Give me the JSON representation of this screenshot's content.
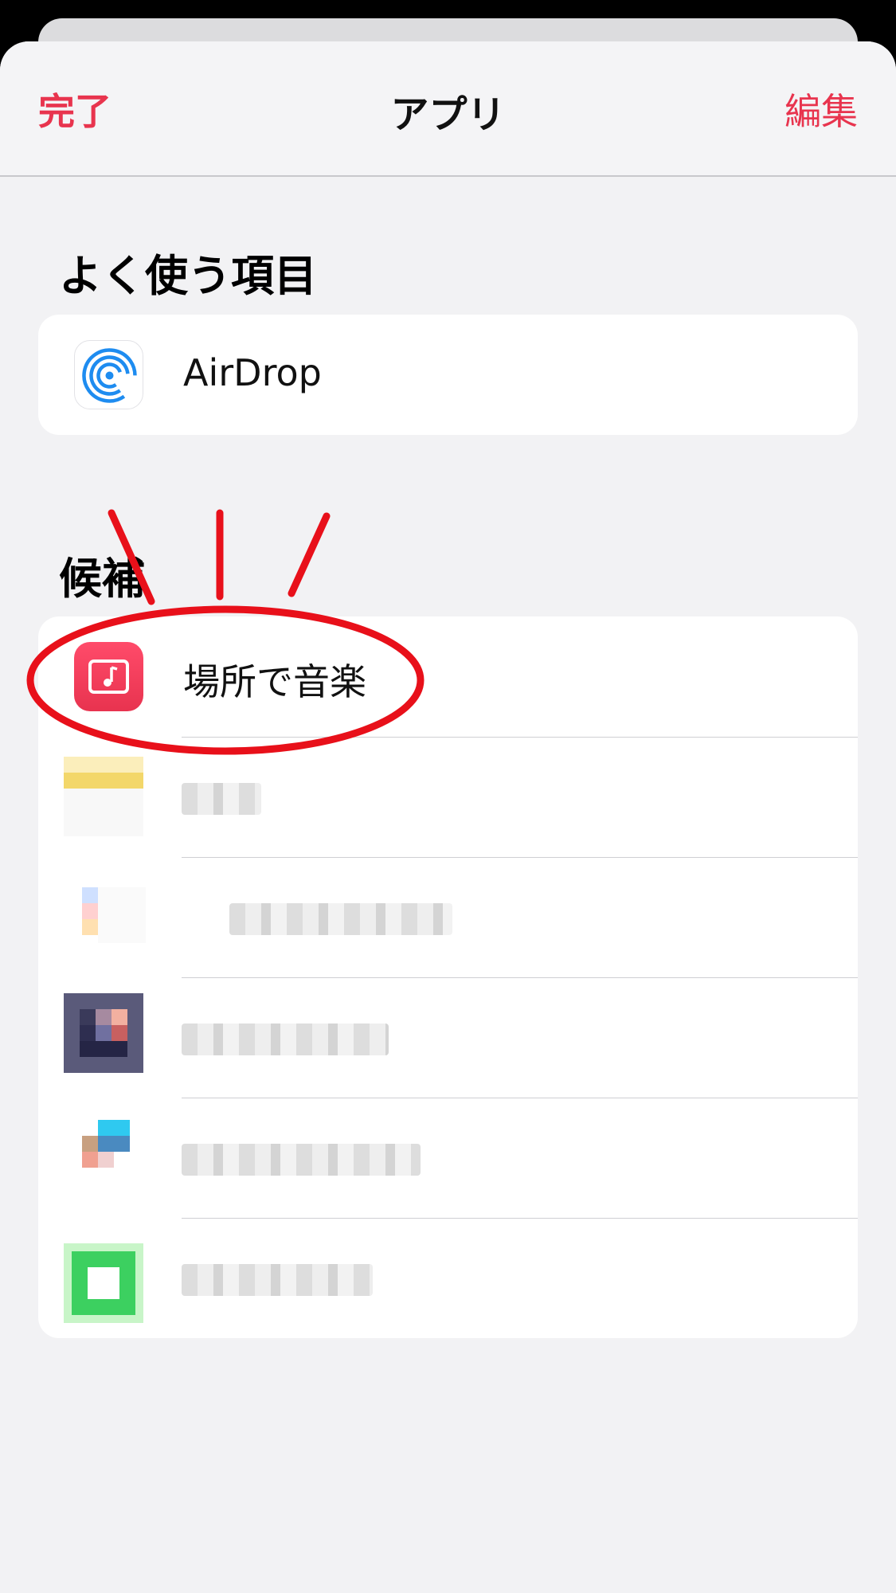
{
  "nav": {
    "done_label": "完了",
    "title": "アプリ",
    "edit_label": "編集"
  },
  "sections": {
    "favorites_header": "よく使う項目",
    "suggestions_header": "候補"
  },
  "favorites": [
    {
      "label": "AirDrop",
      "icon": "airdrop-icon"
    }
  ],
  "suggestions": [
    {
      "label": "場所で音楽",
      "icon": "music-note-icon",
      "highlighted": true
    },
    {
      "label": "",
      "icon": "blurred-app-icon"
    },
    {
      "label": "",
      "icon": "blurred-app-icon"
    },
    {
      "label": "",
      "icon": "blurred-app-icon"
    },
    {
      "label": "",
      "icon": "blurred-app-icon"
    },
    {
      "label": "",
      "icon": "blurred-app-icon"
    }
  ],
  "colors": {
    "accent": "#e8344e",
    "annotation": "#e8101a",
    "airdrop_blue": "#1e8cf0"
  }
}
